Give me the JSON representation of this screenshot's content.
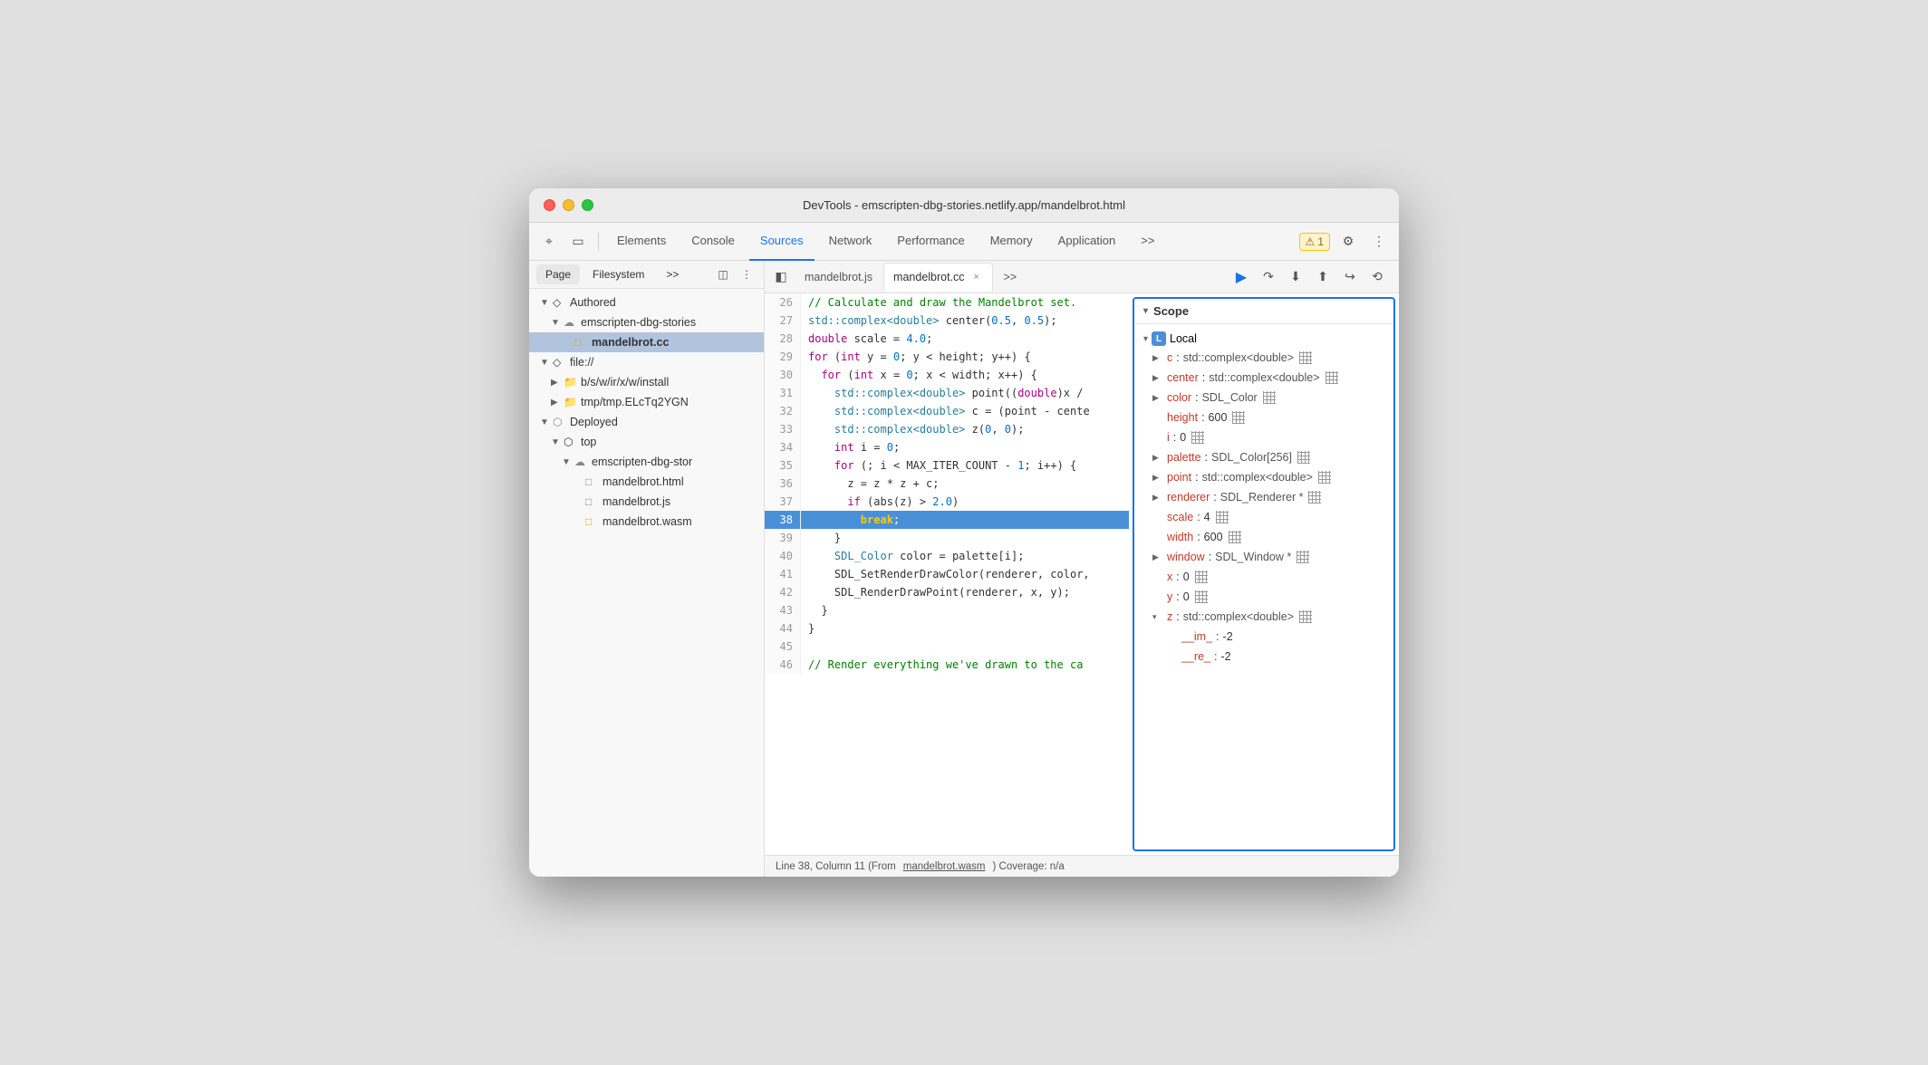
{
  "window": {
    "title": "DevTools - emscripten-dbg-stories.netlify.app/mandelbrot.html"
  },
  "toolbar": {
    "tabs": [
      {
        "id": "elements",
        "label": "Elements",
        "active": false
      },
      {
        "id": "console",
        "label": "Console",
        "active": false
      },
      {
        "id": "sources",
        "label": "Sources",
        "active": true
      },
      {
        "id": "network",
        "label": "Network",
        "active": false
      },
      {
        "id": "performance",
        "label": "Performance",
        "active": false
      },
      {
        "id": "memory",
        "label": "Memory",
        "active": false
      },
      {
        "id": "application",
        "label": "Application",
        "active": false
      }
    ],
    "warning_count": "1",
    "more_label": ">>"
  },
  "sidebar": {
    "tabs": [
      "Page",
      "Filesystem",
      ">>"
    ],
    "tree": [
      {
        "level": 0,
        "type": "section",
        "label": "Authored",
        "expanded": true
      },
      {
        "level": 1,
        "type": "cloud",
        "label": "emscripten-dbg-stories",
        "expanded": true
      },
      {
        "level": 2,
        "type": "file-cc",
        "label": "mandelbrot.cc",
        "selected": true
      },
      {
        "level": 0,
        "type": "section",
        "label": "file://",
        "expanded": true
      },
      {
        "level": 1,
        "type": "folder",
        "label": "b/s/w/ir/x/w/install",
        "expanded": false
      },
      {
        "level": 1,
        "type": "folder",
        "label": "tmp/tmp.ELcTq2YGN",
        "expanded": false
      },
      {
        "level": 0,
        "type": "section",
        "label": "Deployed",
        "expanded": true
      },
      {
        "level": 1,
        "type": "box",
        "label": "top",
        "expanded": true
      },
      {
        "level": 2,
        "type": "cloud",
        "label": "emscripten-dbg-stor",
        "expanded": true
      },
      {
        "level": 3,
        "type": "file-html",
        "label": "mandelbrot.html"
      },
      {
        "level": 3,
        "type": "file-js",
        "label": "mandelbrot.js"
      },
      {
        "level": 3,
        "type": "file-wasm",
        "label": "mandelbrot.wasm"
      }
    ]
  },
  "editor": {
    "tabs": [
      {
        "id": "mandelbrot-js",
        "label": "mandelbrot.js",
        "closable": false,
        "active": false
      },
      {
        "id": "mandelbrot-cc",
        "label": "mandelbrot.cc",
        "closable": true,
        "active": true
      }
    ],
    "highlighted_line": 38,
    "code_lines": [
      {
        "num": 29,
        "content": "for (int y = 0; y < height; y++) {",
        "tokens": [
          {
            "t": "kw",
            "v": "for"
          },
          {
            "t": "plain",
            "v": " ("
          },
          {
            "t": "kw",
            "v": "int"
          },
          {
            "t": "plain",
            "v": " y = "
          },
          {
            "t": "num",
            "v": "0"
          },
          {
            "t": "plain",
            "v": "; y < height; y++) {"
          }
        ]
      },
      {
        "num": 30,
        "content": "  for (int x = 0; x < width; x++) {",
        "tokens": [
          {
            "t": "plain",
            "v": "  "
          },
          {
            "t": "kw",
            "v": "for"
          },
          {
            "t": "plain",
            "v": " ("
          },
          {
            "t": "kw",
            "v": "int"
          },
          {
            "t": "plain",
            "v": " x = "
          },
          {
            "t": "num",
            "v": "0"
          },
          {
            "t": "plain",
            "v": "; x < width; x++) {"
          }
        ]
      },
      {
        "num": 31,
        "content": "    std::complex<double> point((double)x /",
        "tokens": [
          {
            "t": "plain",
            "v": "    "
          },
          {
            "t": "type",
            "v": "std::complex<double>"
          },
          {
            "t": "plain",
            "v": " point(("
          },
          {
            "t": "kw",
            "v": "double"
          },
          {
            "t": "plain",
            "v": ")x /"
          }
        ]
      },
      {
        "num": 32,
        "content": "    std::complex<double> c = (point - cente",
        "tokens": [
          {
            "t": "plain",
            "v": "    "
          },
          {
            "t": "type",
            "v": "std::complex<double>"
          },
          {
            "t": "plain",
            "v": " c = (point - cente"
          }
        ]
      },
      {
        "num": 33,
        "content": "    std::complex<double> z(0, 0);",
        "tokens": [
          {
            "t": "plain",
            "v": "    "
          },
          {
            "t": "type",
            "v": "std::complex<double>"
          },
          {
            "t": "plain",
            "v": " z("
          },
          {
            "t": "num",
            "v": "0"
          },
          {
            "t": "plain",
            "v": ", "
          },
          {
            "t": "num",
            "v": "0"
          },
          {
            "t": "plain",
            "v": ");"
          }
        ]
      },
      {
        "num": 34,
        "content": "    int i = 0;",
        "tokens": [
          {
            "t": "plain",
            "v": "    "
          },
          {
            "t": "kw",
            "v": "int"
          },
          {
            "t": "plain",
            "v": " i = "
          },
          {
            "t": "num",
            "v": "0"
          },
          {
            "t": "plain",
            "v": ";"
          }
        ]
      },
      {
        "num": 35,
        "content": "    for (; i < MAX_ITER_COUNT - 1; i++) {",
        "tokens": [
          {
            "t": "plain",
            "v": "    "
          },
          {
            "t": "kw",
            "v": "for"
          },
          {
            "t": "plain",
            "v": " (; i < MAX_ITER_COUNT - "
          },
          {
            "t": "num",
            "v": "1"
          },
          {
            "t": "plain",
            "v": "; i++) {"
          }
        ]
      },
      {
        "num": 36,
        "content": "      z = z * z + c;",
        "tokens": [
          {
            "t": "plain",
            "v": "      z = z * z + c;"
          }
        ]
      },
      {
        "num": 37,
        "content": "      if (abs(z) > 2.0)",
        "tokens": [
          {
            "t": "plain",
            "v": "      "
          },
          {
            "t": "kw",
            "v": "if"
          },
          {
            "t": "plain",
            "v": " (abs(z) > "
          },
          {
            "t": "num",
            "v": "2.0"
          },
          {
            "t": "plain",
            "v": ")"
          }
        ]
      },
      {
        "num": 38,
        "content": "        break;",
        "highlight": true,
        "tokens": [
          {
            "t": "plain",
            "v": "        "
          },
          {
            "t": "hl-break",
            "v": "break"
          },
          {
            "t": "plain",
            "v": ";"
          }
        ]
      },
      {
        "num": 39,
        "content": "    }",
        "tokens": [
          {
            "t": "plain",
            "v": "    }"
          }
        ]
      },
      {
        "num": 40,
        "content": "    SDL_Color color = palette[i];",
        "tokens": [
          {
            "t": "plain",
            "v": "    "
          },
          {
            "t": "type",
            "v": "SDL_Color"
          },
          {
            "t": "plain",
            "v": " color = palette[i];"
          }
        ]
      },
      {
        "num": 41,
        "content": "    SDL_SetRenderDrawColor(renderer, color,",
        "tokens": [
          {
            "t": "plain",
            "v": "    SDL_SetRenderDrawColor(renderer, color,"
          }
        ]
      },
      {
        "num": 42,
        "content": "    SDL_RenderDrawPoint(renderer, x, y);",
        "tokens": [
          {
            "t": "plain",
            "v": "    SDL_RenderDrawPoint(renderer, x, y);"
          }
        ]
      },
      {
        "num": 43,
        "content": "  }",
        "tokens": [
          {
            "t": "plain",
            "v": "  }"
          }
        ]
      },
      {
        "num": 44,
        "content": "}",
        "tokens": [
          {
            "t": "plain",
            "v": "}"
          }
        ]
      },
      {
        "num": 45,
        "content": "",
        "tokens": []
      },
      {
        "num": 46,
        "content": "// Render everything we've drawn to the ca",
        "tokens": [
          {
            "t": "cm",
            "v": "// Render everything we've drawn to the ca"
          }
        ]
      }
    ],
    "comment_line": "// Calculate and draw the Mandelbrot set.",
    "comment_line_num": 26,
    "std_complex_line": "std::complex<double> center(0.5, 0.5);",
    "std_complex_line_num": 27,
    "double_scale_line": "double scale = 4.0;",
    "double_scale_line_num": 28
  },
  "status_bar": {
    "text": "Line 38, Column 11 (From ",
    "link": "mandelbrot.wasm",
    "text2": ") Coverage: n/a"
  },
  "scope": {
    "title": "Scope",
    "sections": [
      {
        "label": "Local",
        "badge": "L",
        "expanded": true,
        "items": [
          {
            "expandable": true,
            "key": "c",
            "value": "std::complex<double>",
            "has_grid": true
          },
          {
            "expandable": true,
            "key": "center",
            "value": "std::complex<double>",
            "has_grid": true
          },
          {
            "expandable": true,
            "key": "color",
            "value": "SDL_Color",
            "has_grid": true
          },
          {
            "expandable": false,
            "key": "height",
            "value": "600",
            "has_grid": true
          },
          {
            "expandable": false,
            "key": "i",
            "value": "0",
            "has_grid": true
          },
          {
            "expandable": true,
            "key": "palette",
            "value": "SDL_Color[256]",
            "has_grid": true
          },
          {
            "expandable": true,
            "key": "point",
            "value": "std::complex<double>",
            "has_grid": true
          },
          {
            "expandable": true,
            "key": "renderer",
            "value": "SDL_Renderer *",
            "has_grid": true
          },
          {
            "expandable": false,
            "key": "scale",
            "value": "4",
            "has_grid": true
          },
          {
            "expandable": false,
            "key": "width",
            "value": "600",
            "has_grid": true
          },
          {
            "expandable": true,
            "key": "window",
            "value": "SDL_Window *",
            "has_grid": true
          },
          {
            "expandable": false,
            "key": "x",
            "value": "0",
            "has_grid": true
          },
          {
            "expandable": false,
            "key": "y",
            "value": "0",
            "has_grid": true
          },
          {
            "expandable": true,
            "key": "z",
            "value": "std::complex<double>",
            "has_grid": true,
            "expanded": true
          },
          {
            "sub": true,
            "key": "__im_",
            "value": "-2"
          },
          {
            "sub": true,
            "key": "__re_",
            "value": "-2"
          }
        ]
      }
    ]
  },
  "debug_buttons": [
    "resume",
    "step-over",
    "step-into",
    "step-out",
    "step-long",
    "deactivate"
  ],
  "icons": {
    "cursor": "⌖",
    "inspector": "□",
    "chevron_right": "▶",
    "chevron_down": "▼",
    "triangle_right": "▸",
    "triangle_down": "▾",
    "more": "⋮",
    "more_horiz": "»",
    "warning": "⚠",
    "gear": "⚙",
    "close": "×",
    "sidebar_toggle": "◫",
    "resume": "▶",
    "step_over": "↷",
    "step_into": "↓",
    "step_out": "↑",
    "step_long": "⇥",
    "deactivate": "⤺"
  }
}
